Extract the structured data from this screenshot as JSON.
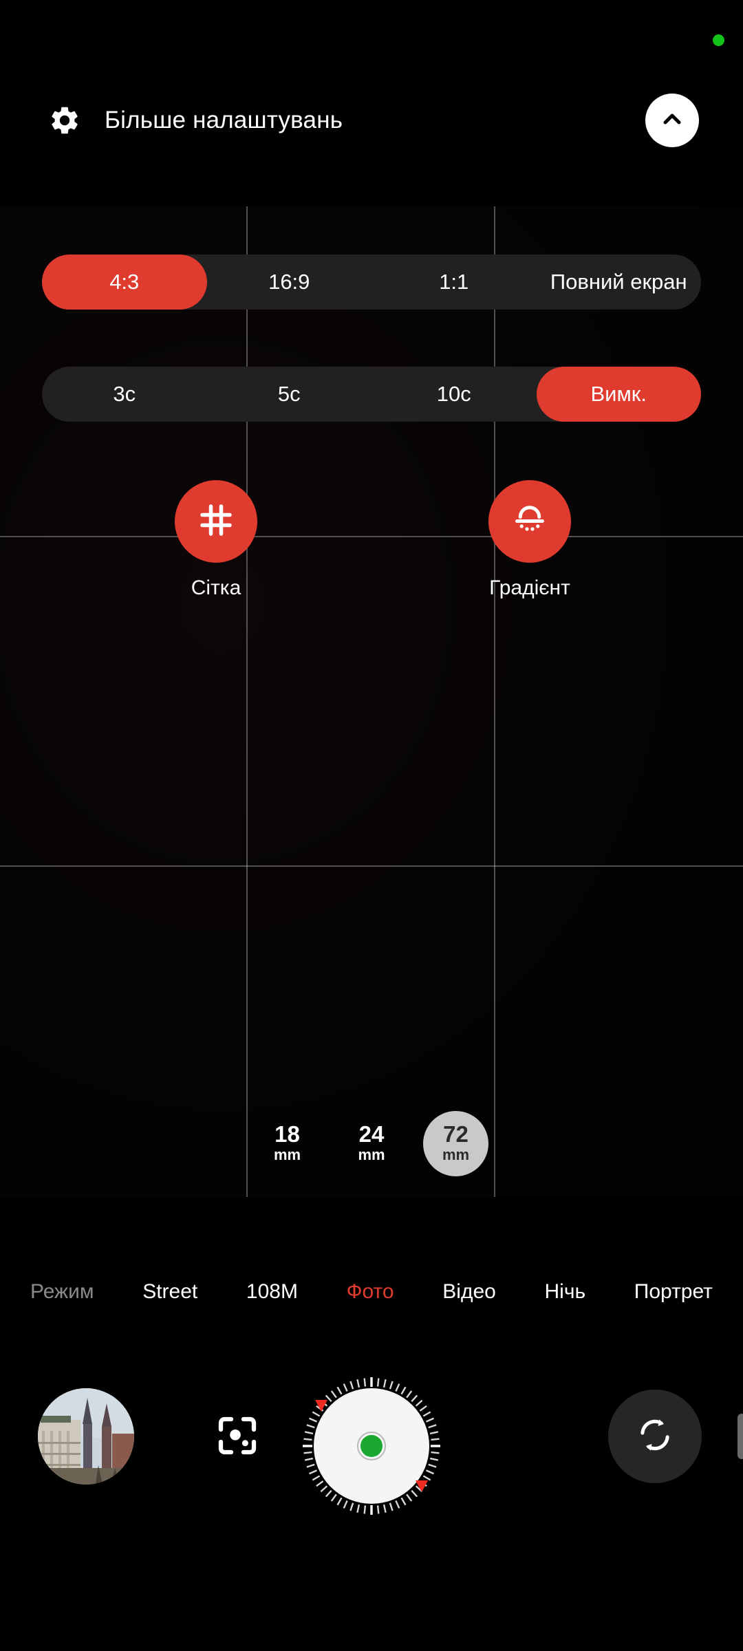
{
  "header": {
    "title": "Більше налаштувань",
    "gear_icon": "gear-icon",
    "collapse_icon": "chevron-up-icon"
  },
  "status": {
    "privacy_indicator": "green-privacy-dot",
    "privacy_color": "#13c319"
  },
  "colors": {
    "accent_red": "#e03b2f",
    "segment_bg": "#212121",
    "selected_lens_bg": "#c9c9c9",
    "shutter_center": "#1aa832"
  },
  "aspect_ratio": {
    "options": [
      {
        "label": "4:3",
        "selected": true
      },
      {
        "label": "16:9",
        "selected": false
      },
      {
        "label": "1:1",
        "selected": false
      },
      {
        "label": "Повний екран",
        "selected": false
      }
    ]
  },
  "timer": {
    "options": [
      {
        "label": "3с",
        "selected": false
      },
      {
        "label": "5с",
        "selected": false
      },
      {
        "label": "10с",
        "selected": false
      },
      {
        "label": "Вимк.",
        "selected": true
      }
    ]
  },
  "toggles": [
    {
      "label": "Сітка",
      "icon": "grid-icon",
      "enabled": true
    },
    {
      "label": "Градієнт",
      "icon": "level-gradient-icon",
      "enabled": true
    }
  ],
  "lenses": [
    {
      "num": "18",
      "unit": "mm",
      "selected": false
    },
    {
      "num": "24",
      "unit": "mm",
      "selected": false
    },
    {
      "num": "72",
      "unit": "mm",
      "selected": true
    }
  ],
  "modes": [
    {
      "label": "Режим",
      "state": "dim"
    },
    {
      "label": "Street",
      "state": "normal"
    },
    {
      "label": "108M",
      "state": "normal"
    },
    {
      "label": "Фото",
      "state": "active"
    },
    {
      "label": "Відео",
      "state": "normal"
    },
    {
      "label": "Нічь",
      "state": "normal"
    },
    {
      "label": "Портрет",
      "state": "normal"
    }
  ],
  "bottom_bar": {
    "gallery_thumbnail": "gallery-thumbnail",
    "ai_scan_icon": "ai-scan-icon",
    "shutter": "shutter-button",
    "flip_icon": "switch-camera-icon",
    "edge_handle": "edge-drag-handle"
  },
  "viewfinder": {
    "grid_overlay": "rule-of-thirds-grid"
  }
}
